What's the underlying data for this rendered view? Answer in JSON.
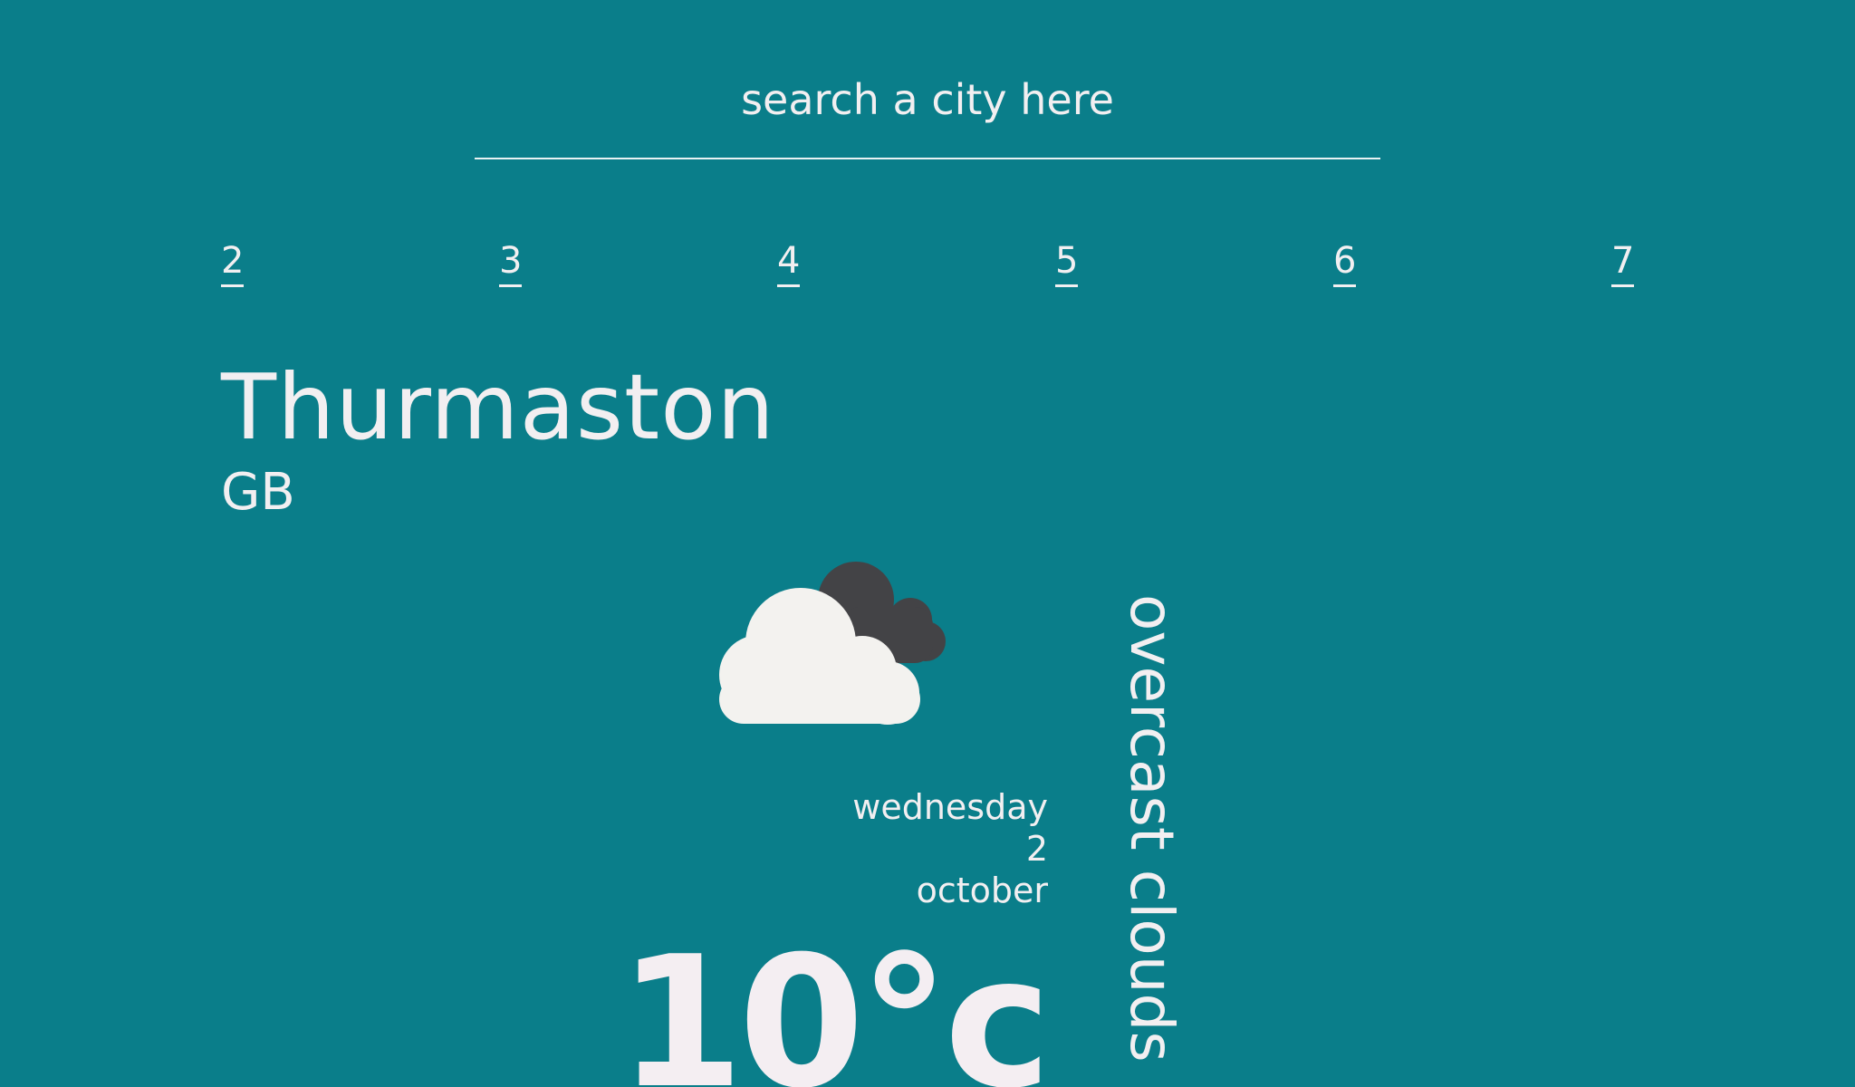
{
  "search": {
    "placeholder": "search a city here"
  },
  "day_tabs": [
    {
      "label": "2"
    },
    {
      "label": "3"
    },
    {
      "label": "4"
    },
    {
      "label": "5"
    },
    {
      "label": "6"
    },
    {
      "label": "7"
    }
  ],
  "location": {
    "city": "Thurmaston",
    "country": "GB"
  },
  "weather": {
    "icon": "overcast-cloud-icon",
    "description": "overcast clouds",
    "temperature": "10°c"
  },
  "date": {
    "weekday": "wednesday",
    "day": "2",
    "month": "october"
  },
  "colors": {
    "background": "#0a7e8a",
    "text": "#f2eff1",
    "cloud_front": "#f3f2ef",
    "cloud_back": "#434346"
  }
}
